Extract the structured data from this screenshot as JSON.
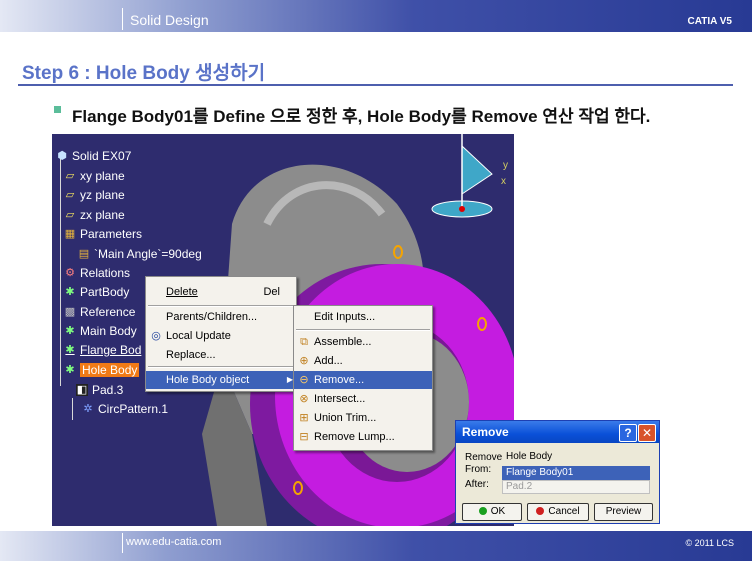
{
  "header": {
    "title": "Solid Design",
    "brand": "CATIA V5"
  },
  "heading": "Step 6 : Hole Body 생성하기",
  "bullet": "Flange Body01를 Define 으로 정한 후, Hole Body를 Remove  연산 작업 한다.",
  "tree": [
    {
      "label": "Solid EX07",
      "icon": "part-icon",
      "selected": false
    },
    {
      "label": "xy plane",
      "icon": "plane-icon",
      "selected": false
    },
    {
      "label": "yz plane",
      "icon": "plane-icon",
      "selected": false
    },
    {
      "label": "zx plane",
      "icon": "plane-icon",
      "selected": false
    },
    {
      "label": "Parameters",
      "icon": "parameters-icon",
      "selected": false
    },
    {
      "label": "`Main Angle`=90deg",
      "icon": "parameter-icon",
      "selected": false
    },
    {
      "label": "Relations",
      "icon": "relations-icon",
      "selected": false
    },
    {
      "label": "PartBody",
      "icon": "body-icon",
      "selected": false
    },
    {
      "label": "Reference",
      "icon": "reference-icon",
      "selected": false
    },
    {
      "label": "Main Body",
      "icon": "body-icon",
      "selected": false
    },
    {
      "label": "Flange Bod",
      "icon": "body-icon",
      "selected": false
    },
    {
      "label": "Hole Body",
      "icon": "body-icon",
      "selected": true
    },
    {
      "label": "Pad.3",
      "icon": "pad-icon",
      "selected": false
    },
    {
      "label": "CircPattern.1",
      "icon": "pattern-icon",
      "selected": false
    }
  ],
  "context_menu": [
    {
      "label": "Delete",
      "shortcut": "Del"
    },
    {
      "label": "Parents/Children..."
    },
    {
      "label": "Local Update"
    },
    {
      "label": "Replace..."
    },
    {
      "label": "Hole Body object"
    }
  ],
  "submenu": [
    {
      "label": "Edit Inputs..."
    },
    {
      "label": "Assemble..."
    },
    {
      "label": "Add..."
    },
    {
      "label": "Remove..."
    },
    {
      "label": "Intersect..."
    },
    {
      "label": "Union Trim..."
    },
    {
      "label": "Remove Lump..."
    }
  ],
  "compass": {
    "y_label": "y",
    "x_label": "x"
  },
  "dialog": {
    "title": "Remove",
    "help": "?",
    "close": "✕",
    "remove_label": "Remove",
    "remove_value": "Hole Body",
    "from_label": "From:",
    "from_value": "Flange Body01",
    "after_label": "After:",
    "after_value": "Pad.2",
    "ok": "OK",
    "cancel": "Cancel",
    "preview": "Preview"
  },
  "footer": {
    "url": "www.edu-catia.com",
    "copyright": "© 2011 LCS"
  },
  "colors": {
    "accent": "#5a73c8",
    "selection": "#f07a16",
    "menu_highlight": "#3d62b8",
    "model": "#c41ce0",
    "viewport": "#2e2c6e"
  }
}
